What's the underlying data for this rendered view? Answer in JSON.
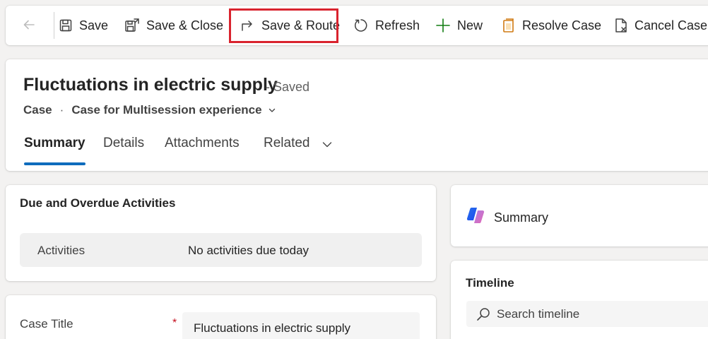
{
  "toolbar": {
    "back_icon": "arrow-left-icon",
    "save": {
      "label": "Save",
      "icon": "floppy-disk-icon"
    },
    "save_close": {
      "label": "Save & Close",
      "icon": "save-close-icon"
    },
    "save_route": {
      "label": "Save & Route",
      "icon": "route-arrow-icon"
    },
    "refresh": {
      "label": "Refresh",
      "icon": "refresh-icon"
    },
    "new": {
      "label": "New",
      "icon": "plus-icon"
    },
    "resolve": {
      "label": "Resolve Case",
      "icon": "resolve-case-icon"
    },
    "cancel": {
      "label": "Cancel Case",
      "icon": "cancel-case-icon"
    },
    "highlight_color": "#d9232e"
  },
  "record": {
    "title": "Fluctuations in electric supply",
    "status": "- Saved",
    "entity": "Case",
    "separator": "·",
    "form": "Case for Multisession experience"
  },
  "tabs": [
    {
      "label": "Summary",
      "active": true
    },
    {
      "label": "Details",
      "active": false
    },
    {
      "label": "Attachments",
      "active": false
    },
    {
      "label": "Related",
      "active": false
    }
  ],
  "activities": {
    "title": "Due and Overdue Activities",
    "label": "Activities",
    "value": "No activities due today"
  },
  "case_title_field": {
    "label": "Case Title",
    "required_mark": "*",
    "value": "Fluctuations in electric supply"
  },
  "summary_panel": {
    "label": "Summary",
    "icon": "copilot-icon"
  },
  "timeline": {
    "title": "Timeline",
    "search_placeholder": "Search timeline",
    "search_icon": "search-icon"
  },
  "colors": {
    "accent": "#0f6cbd",
    "required": "#c50f1f",
    "green_plus": "#107c10",
    "orange": "#d07a12"
  }
}
